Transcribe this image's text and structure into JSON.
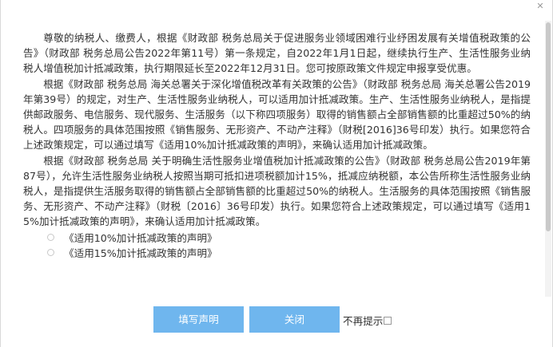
{
  "dialog": {
    "paragraphs": [
      "尊敬的纳税人、缴费人，根据《财政部 税务总局关于促进服务业领域困难行业纾困发展有关增值税政策的公告》（财政部 税务总局公告2022年第11号）第一条规定，自2022年1月1日起，继续执行生产、生活性服务业纳税人增值税加计抵减政策，执行期限延长至2022年12月31日。您可按原政策文件规定申报享受优惠。",
      "根据《财政部 税务总局 海关总署关于深化增值税改革有关政策的公告》（财政部 税务总局 海关总署公告2019年第39号）的规定，对生产、生活性服务业纳税人，可以适用加计抵减政策。生产、生活性服务业纳税人，是指提供邮政服务、电信服务、现代服务、生活服务（以下称四项服务）取得的销售额占全部销售额的比重超过50%的纳税人。四项服务的具体范围按照《销售服务、无形资产、不动产注释》（财税[2016]36号印发）执行。如果您符合上述政策规定，可以通过填写《适用10%加计抵减政策的声明》，来确认适用加计抵减政策。",
      "根据《财政部 税务总局 关于明确生活性服务业增值税加计抵减政策的公告》（财政部 税务总局公告2019年第87号），允许生活性服务业纳税人按照当期可抵扣进项税额加计15%，抵减应纳税额，本公告所称生活性服务业纳税人，是指提供生活服务取得的销售额占全部销售额的比重超过50%的纳税人。生活服务的具体范围按照《销售服务、无形资产、不动产注释》（财税〔2016〕36号印发）执行。如果您符合上述政策规定，可以通过填写《适用15%加计抵减政策的声明》，来确认适用加计抵减政策。"
    ],
    "options": [
      "《适用10%加计抵减政策的声明》",
      "《适用15%加计抵减政策的声明》"
    ],
    "close_glyph": "✕"
  },
  "footer": {
    "fill_label": "填写声明",
    "close_label": "关闭",
    "no_remind_label": "不再提示"
  },
  "colors": {
    "button": "#6fb6ee",
    "text": "#333333"
  }
}
